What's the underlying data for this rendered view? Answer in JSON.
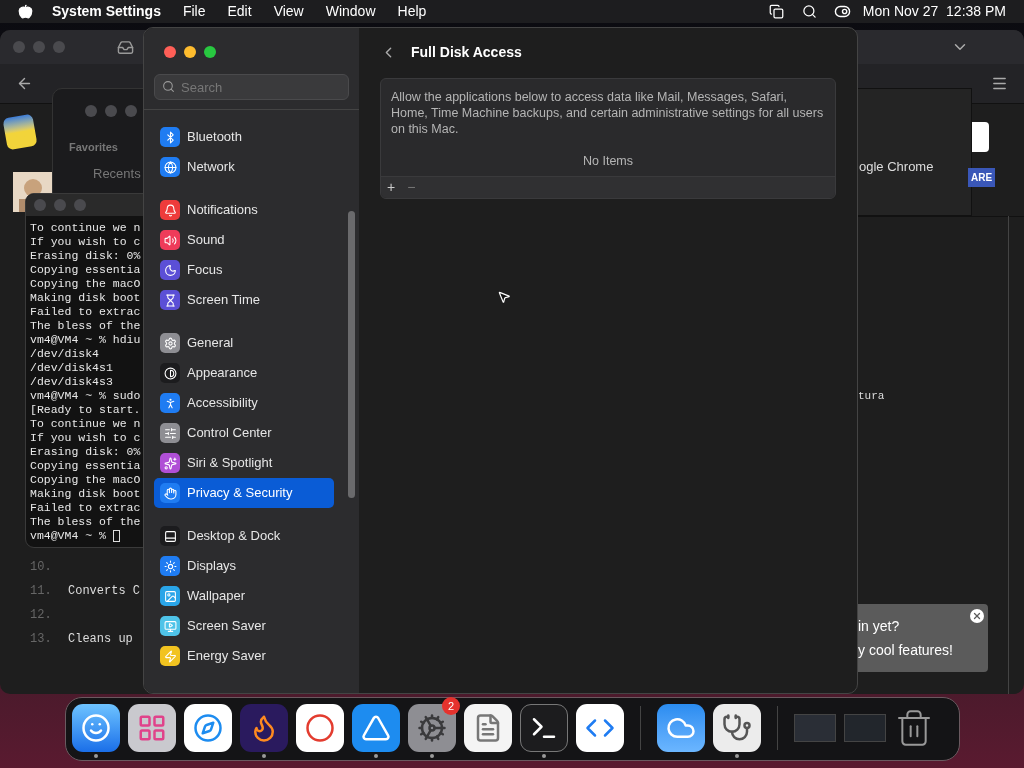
{
  "menu_bar": {
    "app_name": "System Settings",
    "menus": [
      "File",
      "Edit",
      "View",
      "Window",
      "Help"
    ],
    "clock": "Mon Nov 27  12:38 PM"
  },
  "background_window": {
    "right_label": "ogle Chrome",
    "right_badge": "ARE",
    "right_code": "tura"
  },
  "finder_window": {
    "sidebar_heading": "Favorites",
    "sidebar_item": "Recents"
  },
  "terminal": {
    "lines": [
      "To continue we n",
      "If you wish to c",
      "Erasing disk: 0%",
      "Copying essentia",
      "Copying the macO",
      "Making disk boot",
      "Failed to extrac",
      "The bless of the",
      "vm4@VM4 ~ % hdiu",
      "/dev/disk4",
      "/dev/disk4s1",
      "/dev/disk4s3",
      "vm4@VM4 ~ % sudo",
      "[Ready to start.",
      "To continue we n",
      "If you wish to c",
      "Erasing disk: 0%",
      "Copying essentia",
      "Copying the macO",
      "Making disk boot",
      "Failed to extrac",
      "The bless of the",
      "vm4@VM4 ~ % "
    ]
  },
  "code_listing": [
    {
      "number": "10."
    },
    {
      "number": "11.",
      "text": "Converts C"
    },
    {
      "number": "12."
    },
    {
      "number": "13.",
      "text": "Cleans up"
    }
  ],
  "toast": {
    "lines": [
      "in yet?",
      "y cool features!"
    ]
  },
  "settings": {
    "search": {
      "placeholder": "Search"
    },
    "sidebar": {
      "sections": [
        {
          "items": [
            {
              "label": "Bluetooth",
              "selected": false,
              "color": "#1f7cf2"
            },
            {
              "label": "Network",
              "selected": false,
              "color": "#1f7cf2"
            }
          ]
        },
        {
          "items": [
            {
              "label": "Notifications",
              "selected": false,
              "color": "#ee3b3b"
            },
            {
              "label": "Sound",
              "selected": false,
              "color": "#ee3b5a"
            },
            {
              "label": "Focus",
              "selected": false,
              "color": "#5b4fd6"
            },
            {
              "label": "Screen Time",
              "selected": false,
              "color": "#5b4fd6"
            }
          ]
        },
        {
          "items": [
            {
              "label": "General",
              "selected": false,
              "color": "#8e8e93"
            },
            {
              "label": "Appearance",
              "selected": false,
              "color": "#1c1c1e"
            },
            {
              "label": "Accessibility",
              "selected": false,
              "color": "#1f7cf2"
            },
            {
              "label": "Control Center",
              "selected": false,
              "color": "#8e8e93"
            },
            {
              "label": "Siri & Spotlight",
              "selected": false,
              "color": "#b04fd6"
            },
            {
              "label": "Privacy & Security",
              "selected": true,
              "color": "#1f7cf2"
            }
          ]
        },
        {
          "items": [
            {
              "label": "Desktop & Dock",
              "selected": false,
              "color": "#1c1c1e"
            },
            {
              "label": "Displays",
              "selected": false,
              "color": "#1f7cf2"
            },
            {
              "label": "Wallpaper",
              "selected": false,
              "color": "#2aa5e8"
            },
            {
              "label": "Screen Saver",
              "selected": false,
              "color": "#4fc3e8"
            },
            {
              "label": "Energy Saver",
              "selected": false,
              "color": "#f2c320"
            }
          ]
        }
      ]
    },
    "page": {
      "title": "Full Disk Access",
      "description": "Allow the applications below to access data like Mail, Messages, Safari, Home, Time Machine backups, and certain administrative settings for all users on this Mac.",
      "empty_text": "No Items",
      "add_label": "+",
      "remove_label": "−"
    }
  },
  "dock": {
    "apps": [
      {
        "running": true
      },
      {
        "running": false
      },
      {
        "running": false
      },
      {
        "running": true
      },
      {
        "running": false
      },
      {
        "running": true
      },
      {
        "running": true,
        "badge": "2"
      },
      {
        "running": false
      },
      {
        "running": true
      },
      {
        "running": false
      }
    ],
    "others": [
      {
        "running": false
      },
      {
        "running": true
      }
    ]
  }
}
